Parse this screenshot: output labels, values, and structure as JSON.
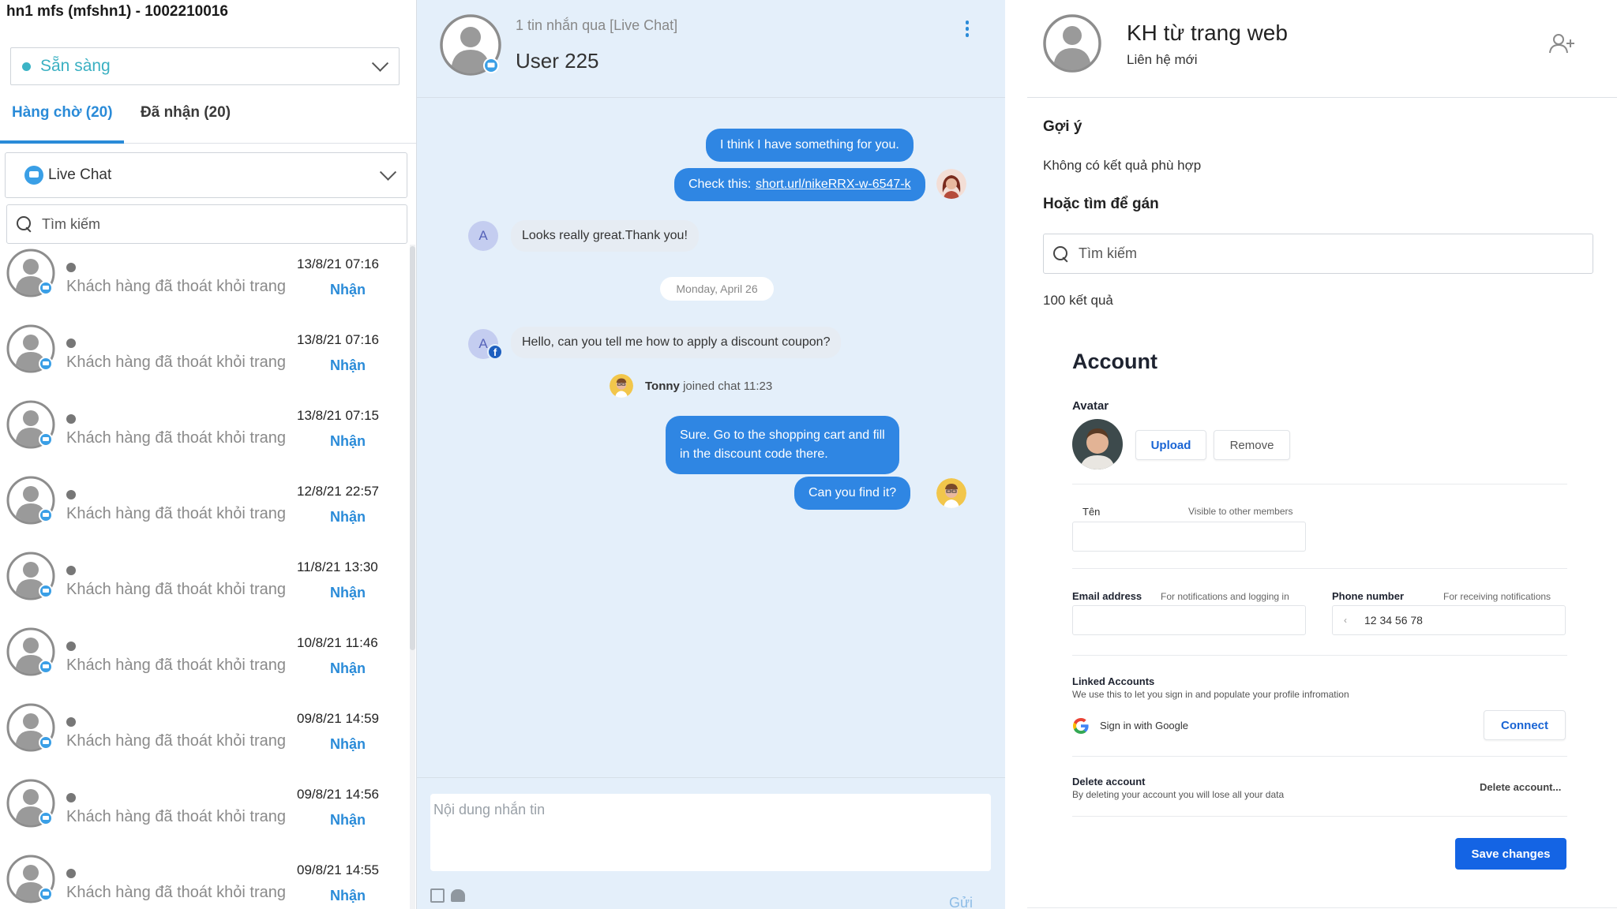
{
  "left": {
    "title": "hn1 mfs (mfshn1) - 1002210016",
    "status": "Sẵn sàng",
    "tabs": {
      "queue": "Hàng chờ (20)",
      "received": "Đã nhận (20)"
    },
    "channel": "Live Chat",
    "search_placeholder": "Tìm kiếm",
    "conversations": [
      {
        "message": "Khách hàng đã thoát khỏi trang",
        "time": "13/8/21 07:16",
        "action": "Nhận"
      },
      {
        "message": "Khách hàng đã thoát khỏi trang",
        "time": "13/8/21 07:16",
        "action": "Nhận"
      },
      {
        "message": "Khách hàng đã thoát khỏi trang",
        "time": "13/8/21 07:15",
        "action": "Nhận"
      },
      {
        "message": "Khách hàng đã thoát khỏi trang",
        "time": "12/8/21 22:57",
        "action": "Nhận"
      },
      {
        "message": "Khách hàng đã thoát khỏi trang",
        "time": "11/8/21 13:30",
        "action": "Nhận"
      },
      {
        "message": "Khách hàng đã thoát khỏi trang",
        "time": "10/8/21 11:46",
        "action": "Nhận"
      },
      {
        "message": "Khách hàng đã thoát khỏi trang",
        "time": "09/8/21 14:59",
        "action": "Nhận"
      },
      {
        "message": "Khách hàng đã thoát khỏi trang",
        "time": "09/8/21 14:56",
        "action": "Nhận"
      },
      {
        "message": "Khách hàng đã thoát khỏi trang",
        "time": "09/8/21 14:55",
        "action": "Nhận"
      }
    ]
  },
  "chat": {
    "subtitle": "1 tin nhắn qua [Live Chat]",
    "user_name": "User 225",
    "messages": {
      "m1": "I think I have something for you.",
      "m2_prefix": "Check this:",
      "m2_link": "short.url/nikeRRX-w-6547-k",
      "m3": "Looks really great.Thank you!",
      "date_separator": "Monday, April 26",
      "m4": "Hello, can you tell me how to apply a discount coupon?",
      "join_name": "Tonny",
      "join_text": "joined chat",
      "join_time": "11:23",
      "m5_line1": "Sure. Go to the shopping cart and fill",
      "m5_line2": "in the discount code there.",
      "m6": "Can you find it?"
    },
    "customer_initial": "A",
    "composer_placeholder": "Nội dung nhắn tin",
    "send_label": "Gửi"
  },
  "contact": {
    "name": "KH từ trang web",
    "subtitle": "Liên hệ mới",
    "suggest_title": "Gợi ý",
    "no_result": "Không có kết quả phù hợp",
    "assign_title": "Hoặc tìm để gán",
    "search_placeholder": "Tìm kiếm",
    "result_count": "100 kết quả"
  },
  "account": {
    "title": "Account",
    "avatar_label": "Avatar",
    "upload": "Upload",
    "remove": "Remove",
    "name_label": "Tên",
    "name_hint": "Visible to other members",
    "email_label": "Email address",
    "email_hint": "For notifications and logging in",
    "phone_label": "Phone number",
    "phone_hint": "For receiving notifications",
    "phone_prefix": "‹",
    "phone_value": "12 34 56 78",
    "linked_title": "Linked Accounts",
    "linked_hint": "We use this to let you sign in and populate your profile infromation",
    "google_label": "Sign in with Google",
    "connect": "Connect",
    "delete_title": "Delete account",
    "delete_hint": "By deleting your account you will lose all your data",
    "delete_link": "Delete account...",
    "save": "Save changes"
  },
  "colors": {
    "accent": "#2a8bd8",
    "status_green": "#3cb4c6",
    "bubble_out": "#2f86e3",
    "chat_bg": "#e4effa",
    "save_button": "#1464e4"
  },
  "icons": [
    "search-icon",
    "chevron-down-icon",
    "live-chat-icon",
    "kebab-menu-icon",
    "add-user-icon",
    "image-icon",
    "android-icon",
    "google-icon",
    "facebook-icon"
  ]
}
